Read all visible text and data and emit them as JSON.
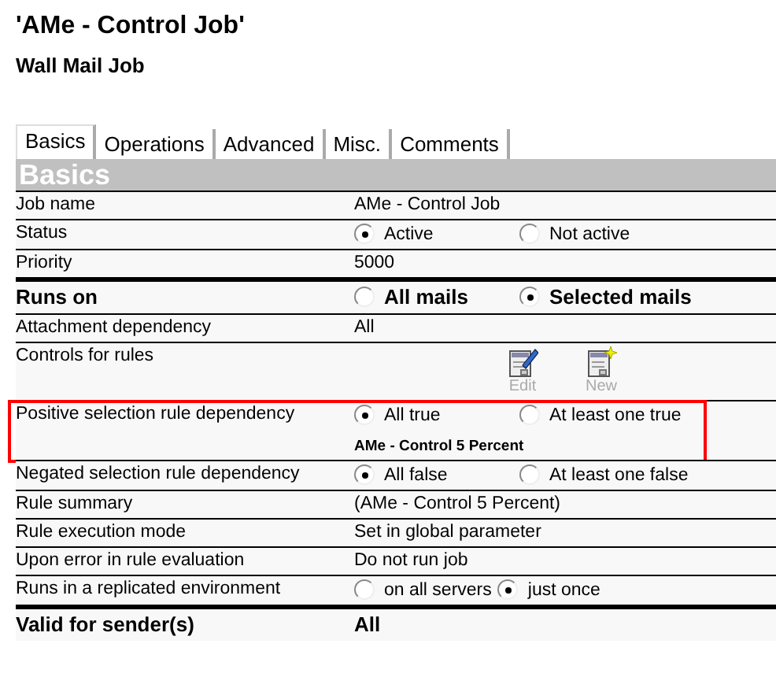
{
  "title": "'AMe - Control Job'",
  "subtitle": "Wall Mail Job",
  "tabs": [
    {
      "label": "Basics",
      "selected": true
    },
    {
      "label": "Operations",
      "selected": false
    },
    {
      "label": "Advanced",
      "selected": false
    },
    {
      "label": "Misc.",
      "selected": false
    },
    {
      "label": "Comments",
      "selected": false
    }
  ],
  "section": "Basics",
  "rows": [
    {
      "kind": "text",
      "label": "Job name",
      "value": "AMe - Control Job"
    },
    {
      "kind": "radio",
      "label": "Status",
      "options": [
        {
          "label": "Active",
          "selected": true
        },
        {
          "label": "Not active",
          "selected": false
        }
      ]
    },
    {
      "kind": "text",
      "label": "Priority",
      "value": "5000"
    },
    {
      "kind": "radio",
      "label": "Runs on",
      "bold": true,
      "options": [
        {
          "label": "All mails",
          "selected": false
        },
        {
          "label": "Selected mails",
          "selected": true
        }
      ]
    },
    {
      "kind": "text",
      "label": "Attachment dependency",
      "value": "All"
    },
    {
      "kind": "controls",
      "label": "Controls for rules",
      "buttons": [
        {
          "label": "Edit",
          "kind": "edit",
          "disabled": true
        },
        {
          "label": "New",
          "kind": "new",
          "disabled": true
        }
      ]
    },
    {
      "kind": "radio",
      "label": "Positive selection rule dependency",
      "highlighted": true,
      "options": [
        {
          "label": "All true",
          "selected": true
        },
        {
          "label": "At least one true",
          "selected": false
        }
      ],
      "note": "AMe - Control 5 Percent"
    },
    {
      "kind": "radio",
      "label": "Negated selection rule dependency",
      "options": [
        {
          "label": "All false",
          "selected": true
        },
        {
          "label": "At least one false",
          "selected": false
        }
      ]
    },
    {
      "kind": "text",
      "label": "Rule summary",
      "value": "(AMe - Control 5 Percent)"
    },
    {
      "kind": "text",
      "label": "Rule execution mode",
      "value": "Set in global parameter"
    },
    {
      "kind": "text",
      "label": "Upon error in rule evaluation",
      "value": "Do not run job"
    },
    {
      "kind": "radio",
      "label": "Runs in a replicated environment",
      "compact": true,
      "options": [
        {
          "label": "on all servers",
          "selected": false
        },
        {
          "label": "just once",
          "selected": true
        }
      ]
    },
    {
      "kind": "text",
      "label": "Valid for sender(s)",
      "bold": true,
      "value": "All"
    }
  ]
}
